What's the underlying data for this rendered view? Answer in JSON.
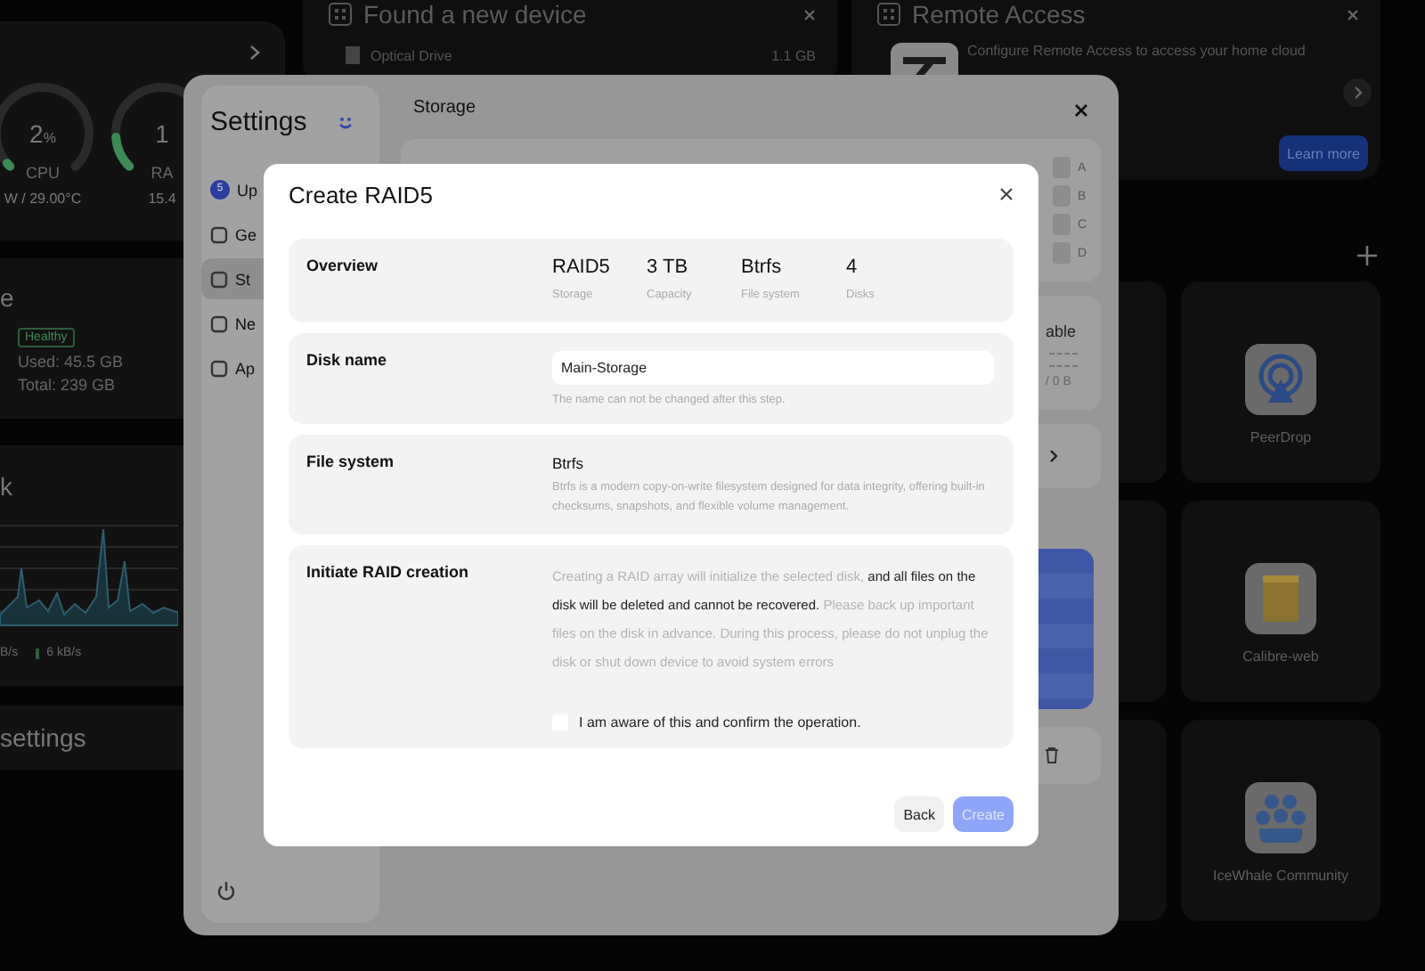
{
  "dashboard": {
    "system_card": {
      "gauges": [
        {
          "value": "2",
          "unit": "%",
          "label": "CPU",
          "reading": "W / 29.00°C",
          "level": 0.02
        },
        {
          "value": "1",
          "label": "RA",
          "reading": "15.4",
          "level": 0.15
        }
      ]
    },
    "storage_card": {
      "title": "e",
      "status": "Healthy",
      "used": "Used: 45.5 GB",
      "total": "Total: 239 GB"
    },
    "network_card": {
      "title": "k",
      "upload": "B/s",
      "download": "6 kB/s"
    },
    "settings_card": {
      "title": "settings"
    }
  },
  "device_notice": {
    "title": "Found a new device",
    "device": "Optical Drive",
    "size": "1.1 GB"
  },
  "remote_notice": {
    "title": "Remote Access",
    "message": "Configure Remote Access to access your home cloud",
    "button": "Learn more"
  },
  "apps": [
    {
      "name": "PeerDrop"
    },
    {
      "name": "Calibre-web"
    },
    {
      "name": "IceWhale Community"
    }
  ],
  "settings_window": {
    "title": "Settings",
    "sidebar": [
      {
        "label": "Up",
        "badge": "5",
        "selected": false
      },
      {
        "label": "Ge",
        "selected": false
      },
      {
        "label": "St",
        "selected": true
      },
      {
        "label": "Ne",
        "selected": false
      },
      {
        "label": "Ap",
        "selected": false
      }
    ],
    "page_title": "Storage",
    "disk_slots": [
      "A",
      "B",
      "C",
      "D"
    ],
    "storage_label": "able",
    "storage_reading": "/ 0 B"
  },
  "dialog": {
    "title": "Create RAID5",
    "overview": {
      "label": "Overview",
      "stats": [
        {
          "value": "RAID5",
          "label": "Storage"
        },
        {
          "value": "3 TB",
          "label": "Capacity"
        },
        {
          "value": "Btrfs",
          "label": "File system"
        },
        {
          "value": "4",
          "label": "Disks"
        }
      ]
    },
    "disk_name": {
      "label": "Disk name",
      "value": "Main-Storage",
      "hint": "The name can not be changed after this step."
    },
    "file_system": {
      "label": "File system",
      "value": "Btrfs",
      "description": "Btrfs is a modern copy-on-write filesystem designed for data integrity, offering built-in checksums, snapshots, and flexible volume management."
    },
    "initiate": {
      "label": "Initiate RAID creation",
      "warning": "Creating a RAID array will initialize the selected disk, **and all files on the disk will be deleted and cannot be recovered.** Please back up important files on the disk in advance. During this process, please do not unplug the disk or shut down device to avoid system errors",
      "confirm_label": "I am aware of this and confirm the operation.",
      "checked": false
    },
    "back_button": "Back",
    "create_button": {
      "label": "Create",
      "disabled": true
    }
  }
}
